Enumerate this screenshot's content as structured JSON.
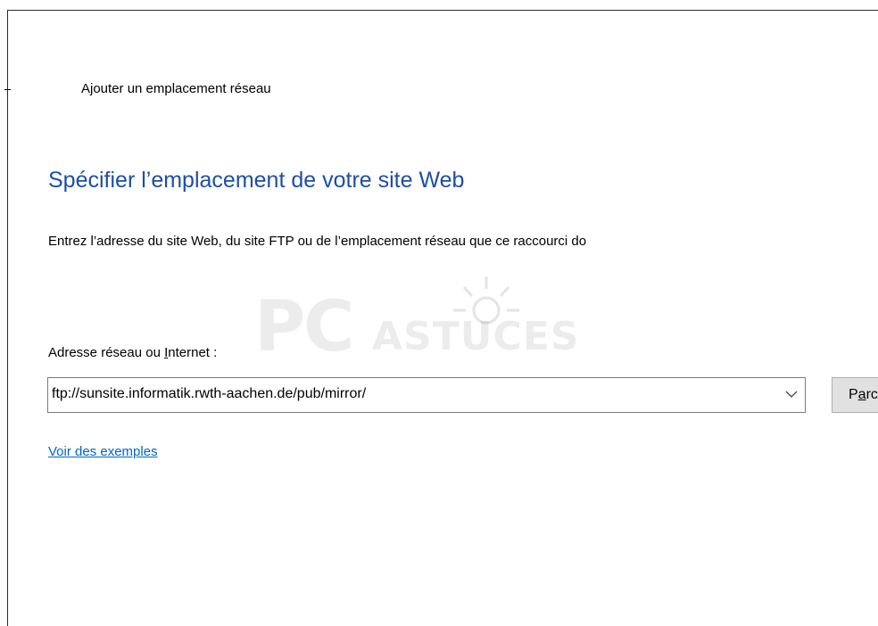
{
  "wizard": {
    "title": "Ajouter un emplacement réseau",
    "heading": "Spécifier l’emplacement de votre site Web",
    "description": "Entrez l’adresse du site Web, du site FTP ou de l’emplacement réseau que ce raccourci do"
  },
  "address": {
    "label_prefix": "Adresse réseau ou ",
    "label_accel": "I",
    "label_suffix": "nternet :",
    "value": "ftp://sunsite.informatik.rwth-aachen.de/pub/mirror/",
    "dropdown_icon": "chevron-down-icon"
  },
  "browse": {
    "label_prefix": "P",
    "label_accel": "a",
    "label_suffix": "rc"
  },
  "examples_link": "Voir des exemples",
  "watermark": {
    "logo_pc": "PC",
    "logo_astuces": "ASTUCES"
  },
  "colors": {
    "heading": "#1e4ea8",
    "link": "#0066cc",
    "border": "#7a7a7a"
  }
}
